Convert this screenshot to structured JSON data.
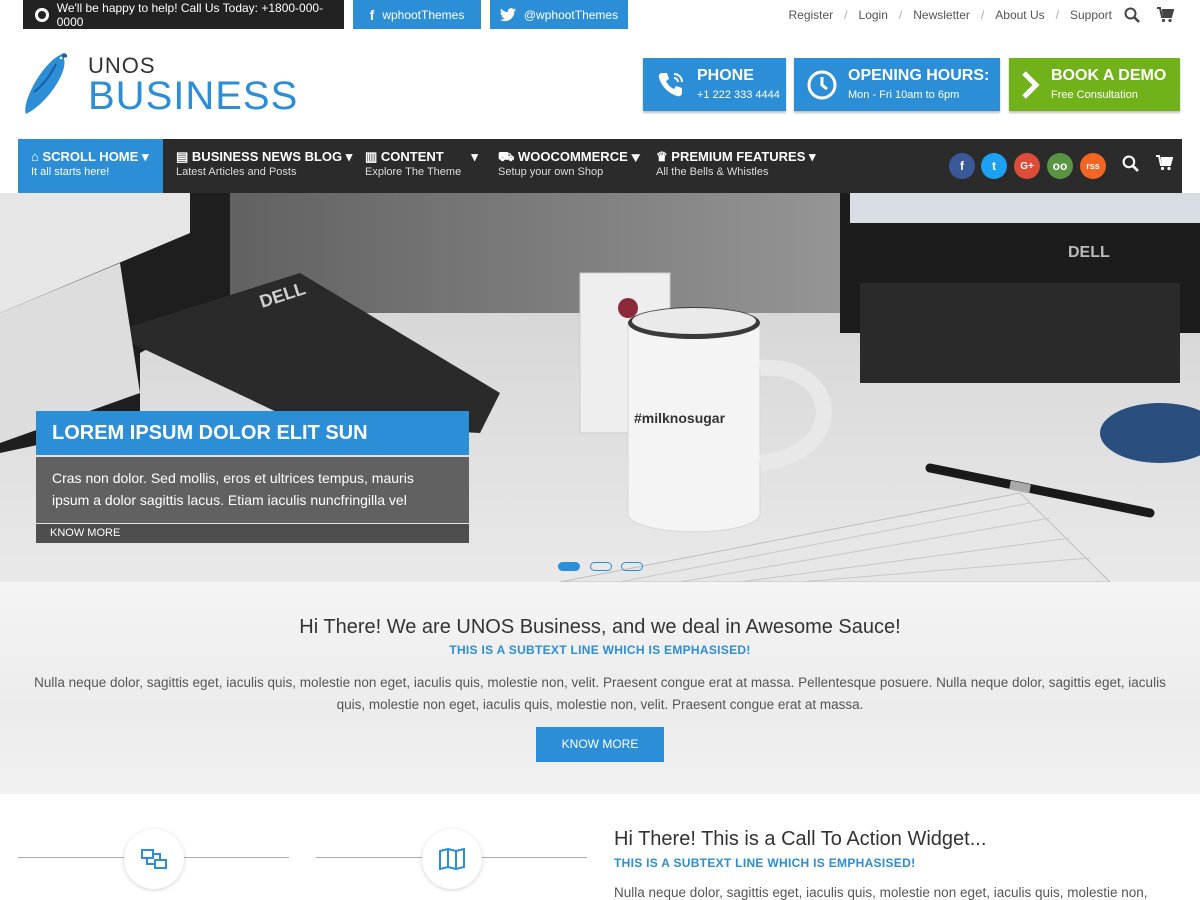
{
  "topbar": {
    "help_text": "We'll be happy to help! Call Us Today: +1800-000-0000",
    "facebook": "wphootThemes",
    "twitter": "@wphootThemes",
    "links": [
      "Register",
      "Login",
      "Newsletter",
      "About Us",
      "Support"
    ]
  },
  "logo": {
    "small": "UNOS",
    "big": "BUSINESS"
  },
  "header_boxes": {
    "phone": {
      "title": "PHONE",
      "sub": "+1 222 333 4444"
    },
    "hours": {
      "title": "OPENING HOURS:",
      "sub": "Mon - Fri 10am to 6pm"
    },
    "demo": {
      "title": "BOOK A DEMO",
      "sub": "Free Consultation"
    }
  },
  "nav": {
    "items": [
      {
        "title": "SCROLL HOME",
        "sub": "It all starts here!"
      },
      {
        "title": "BUSINESS NEWS BLOG",
        "sub": "Latest Articles and Posts"
      },
      {
        "title": "CONTENT",
        "sub": "Explore The Theme"
      },
      {
        "title": "WOOCOMMERCE",
        "sub": "Setup your own Shop"
      },
      {
        "title": "PREMIUM FEATURES",
        "sub": "All the Bells & Whistles"
      }
    ],
    "social": [
      "f",
      "t",
      "G+",
      "oo",
      "rss"
    ]
  },
  "slider": {
    "title": "LOREM IPSUM DOLOR ELIT SUN",
    "text": "Cras non dolor. Sed mollis, eros et ultrices tempus, mauris ipsum a dolor sagittis lacus. Etiam iaculis nuncfringilla vel",
    "button": "KNOW MORE",
    "mug_text": "#milknosugar",
    "monitor_brand": "DELL",
    "active_slide": 1,
    "slide_count": 3
  },
  "intro": {
    "title": "Hi There! We are UNOS Business, and we deal in Awesome Sauce!",
    "subtitle": "THIS IS A SUBTEXT LINE WHICH IS EMPHASISED!",
    "body": "Nulla neque dolor, sagittis eget, iaculis quis, molestie non eget, iaculis quis, molestie non, velit. Praesent congue erat at massa. Pellentesque posuere. Nulla neque dolor, sagittis eget, iaculis quis, molestie non eget, iaculis quis, molestie non, velit. Praesent congue erat at massa.",
    "button": "KNOW MORE"
  },
  "cta": {
    "title": "Hi There! This is a Call To Action Widget...",
    "subtitle": "THIS IS A SUBTEXT LINE WHICH IS EMPHASISED!",
    "body": "Nulla neque dolor, sagittis eget, iaculis quis, molestie non eget, iaculis quis, molestie non,"
  },
  "colors": {
    "accent": "#2b8ed6",
    "green": "#71b11a",
    "dark": "#2b2b2b"
  }
}
